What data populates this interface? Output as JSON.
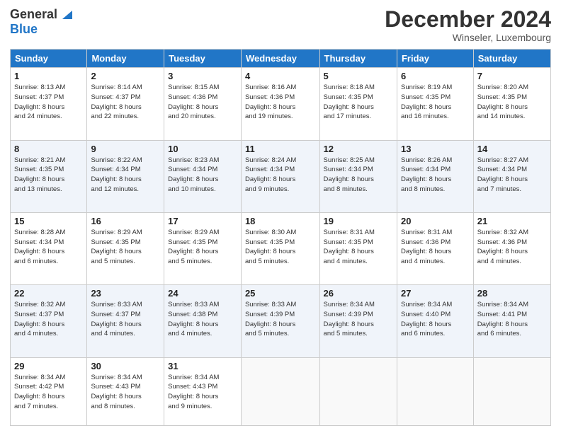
{
  "header": {
    "logo_line1": "General",
    "logo_line2": "Blue",
    "month_title": "December 2024",
    "location": "Winseler, Luxembourg"
  },
  "days_of_week": [
    "Sunday",
    "Monday",
    "Tuesday",
    "Wednesday",
    "Thursday",
    "Friday",
    "Saturday"
  ],
  "weeks": [
    [
      {
        "day": "1",
        "info": "Sunrise: 8:13 AM\nSunset: 4:37 PM\nDaylight: 8 hours\nand 24 minutes."
      },
      {
        "day": "2",
        "info": "Sunrise: 8:14 AM\nSunset: 4:37 PM\nDaylight: 8 hours\nand 22 minutes."
      },
      {
        "day": "3",
        "info": "Sunrise: 8:15 AM\nSunset: 4:36 PM\nDaylight: 8 hours\nand 20 minutes."
      },
      {
        "day": "4",
        "info": "Sunrise: 8:16 AM\nSunset: 4:36 PM\nDaylight: 8 hours\nand 19 minutes."
      },
      {
        "day": "5",
        "info": "Sunrise: 8:18 AM\nSunset: 4:35 PM\nDaylight: 8 hours\nand 17 minutes."
      },
      {
        "day": "6",
        "info": "Sunrise: 8:19 AM\nSunset: 4:35 PM\nDaylight: 8 hours\nand 16 minutes."
      },
      {
        "day": "7",
        "info": "Sunrise: 8:20 AM\nSunset: 4:35 PM\nDaylight: 8 hours\nand 14 minutes."
      }
    ],
    [
      {
        "day": "8",
        "info": "Sunrise: 8:21 AM\nSunset: 4:35 PM\nDaylight: 8 hours\nand 13 minutes."
      },
      {
        "day": "9",
        "info": "Sunrise: 8:22 AM\nSunset: 4:34 PM\nDaylight: 8 hours\nand 12 minutes."
      },
      {
        "day": "10",
        "info": "Sunrise: 8:23 AM\nSunset: 4:34 PM\nDaylight: 8 hours\nand 10 minutes."
      },
      {
        "day": "11",
        "info": "Sunrise: 8:24 AM\nSunset: 4:34 PM\nDaylight: 8 hours\nand 9 minutes."
      },
      {
        "day": "12",
        "info": "Sunrise: 8:25 AM\nSunset: 4:34 PM\nDaylight: 8 hours\nand 8 minutes."
      },
      {
        "day": "13",
        "info": "Sunrise: 8:26 AM\nSunset: 4:34 PM\nDaylight: 8 hours\nand 8 minutes."
      },
      {
        "day": "14",
        "info": "Sunrise: 8:27 AM\nSunset: 4:34 PM\nDaylight: 8 hours\nand 7 minutes."
      }
    ],
    [
      {
        "day": "15",
        "info": "Sunrise: 8:28 AM\nSunset: 4:34 PM\nDaylight: 8 hours\nand 6 minutes."
      },
      {
        "day": "16",
        "info": "Sunrise: 8:29 AM\nSunset: 4:35 PM\nDaylight: 8 hours\nand 5 minutes."
      },
      {
        "day": "17",
        "info": "Sunrise: 8:29 AM\nSunset: 4:35 PM\nDaylight: 8 hours\nand 5 minutes."
      },
      {
        "day": "18",
        "info": "Sunrise: 8:30 AM\nSunset: 4:35 PM\nDaylight: 8 hours\nand 5 minutes."
      },
      {
        "day": "19",
        "info": "Sunrise: 8:31 AM\nSunset: 4:35 PM\nDaylight: 8 hours\nand 4 minutes."
      },
      {
        "day": "20",
        "info": "Sunrise: 8:31 AM\nSunset: 4:36 PM\nDaylight: 8 hours\nand 4 minutes."
      },
      {
        "day": "21",
        "info": "Sunrise: 8:32 AM\nSunset: 4:36 PM\nDaylight: 8 hours\nand 4 minutes."
      }
    ],
    [
      {
        "day": "22",
        "info": "Sunrise: 8:32 AM\nSunset: 4:37 PM\nDaylight: 8 hours\nand 4 minutes."
      },
      {
        "day": "23",
        "info": "Sunrise: 8:33 AM\nSunset: 4:37 PM\nDaylight: 8 hours\nand 4 minutes."
      },
      {
        "day": "24",
        "info": "Sunrise: 8:33 AM\nSunset: 4:38 PM\nDaylight: 8 hours\nand 4 minutes."
      },
      {
        "day": "25",
        "info": "Sunrise: 8:33 AM\nSunset: 4:39 PM\nDaylight: 8 hours\nand 5 minutes."
      },
      {
        "day": "26",
        "info": "Sunrise: 8:34 AM\nSunset: 4:39 PM\nDaylight: 8 hours\nand 5 minutes."
      },
      {
        "day": "27",
        "info": "Sunrise: 8:34 AM\nSunset: 4:40 PM\nDaylight: 8 hours\nand 6 minutes."
      },
      {
        "day": "28",
        "info": "Sunrise: 8:34 AM\nSunset: 4:41 PM\nDaylight: 8 hours\nand 6 minutes."
      }
    ],
    [
      {
        "day": "29",
        "info": "Sunrise: 8:34 AM\nSunset: 4:42 PM\nDaylight: 8 hours\nand 7 minutes."
      },
      {
        "day": "30",
        "info": "Sunrise: 8:34 AM\nSunset: 4:43 PM\nDaylight: 8 hours\nand 8 minutes."
      },
      {
        "day": "31",
        "info": "Sunrise: 8:34 AM\nSunset: 4:43 PM\nDaylight: 8 hours\nand 9 minutes."
      },
      {
        "day": "",
        "info": ""
      },
      {
        "day": "",
        "info": ""
      },
      {
        "day": "",
        "info": ""
      },
      {
        "day": "",
        "info": ""
      }
    ]
  ]
}
